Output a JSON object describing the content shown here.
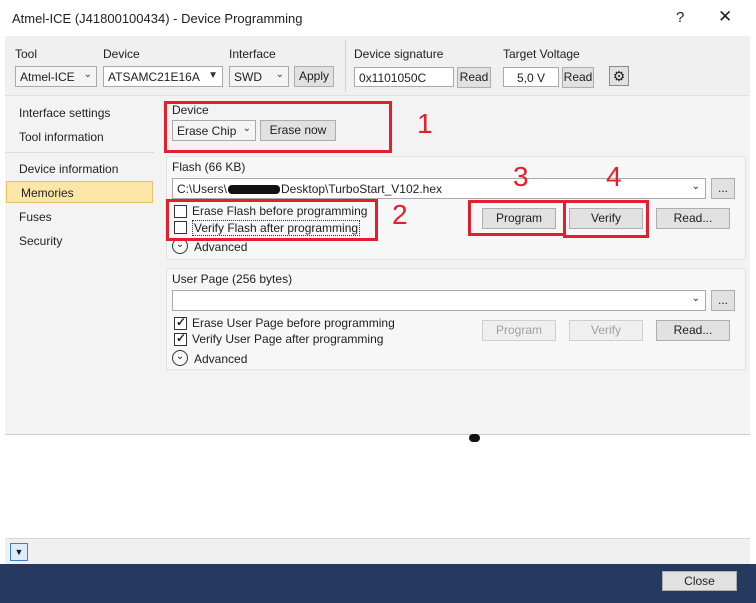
{
  "window": {
    "title": "Atmel-ICE (J41800100434) - Device Programming",
    "help_label": "?",
    "close_label": "✕"
  },
  "toolbar": {
    "tool_label": "Tool",
    "tool_value": "Atmel-ICE",
    "device_label": "Device",
    "device_value": "ATSAMC21E16A",
    "interface_label": "Interface",
    "interface_value": "SWD",
    "apply_label": "Apply",
    "signature_label": "Device signature",
    "signature_value": "0x1101050C",
    "signature_read": "Read",
    "voltage_label": "Target Voltage",
    "voltage_value": "5,0 V",
    "voltage_read": "Read"
  },
  "sidebar": {
    "items": [
      {
        "label": "Interface settings"
      },
      {
        "label": "Tool information"
      },
      {
        "label": "Device information"
      },
      {
        "label": "Memories"
      },
      {
        "label": "Fuses"
      },
      {
        "label": "Security"
      }
    ],
    "selected": "Memories"
  },
  "device_section": {
    "label": "Device",
    "erase_mode": "Erase Chip",
    "erase_now": "Erase now"
  },
  "flash": {
    "label": "Flash (66 KB)",
    "path": "C:\\Users\\",
    "path_tail": "Desktop\\TurboStart_V102.hex",
    "browse": "...",
    "erase_before": "Erase Flash before programming",
    "verify_after": "Verify Flash after programming",
    "program": "Program",
    "verify": "Verify",
    "read": "Read...",
    "advanced": "Advanced"
  },
  "user_page": {
    "label": "User Page (256 bytes)",
    "path": "",
    "browse": "...",
    "erase_before": "Erase User Page before programming",
    "verify_after": "Verify User Page after programming",
    "program": "Program",
    "verify": "Verify",
    "read": "Read...",
    "advanced": "Advanced"
  },
  "annotations": {
    "n1": "1",
    "n2": "2",
    "n3": "3",
    "n4": "4",
    "color": "#e21f2b"
  },
  "footer": {
    "close": "Close"
  },
  "colors": {
    "selection": "#fbe6a8",
    "footer": "#253a5e"
  }
}
